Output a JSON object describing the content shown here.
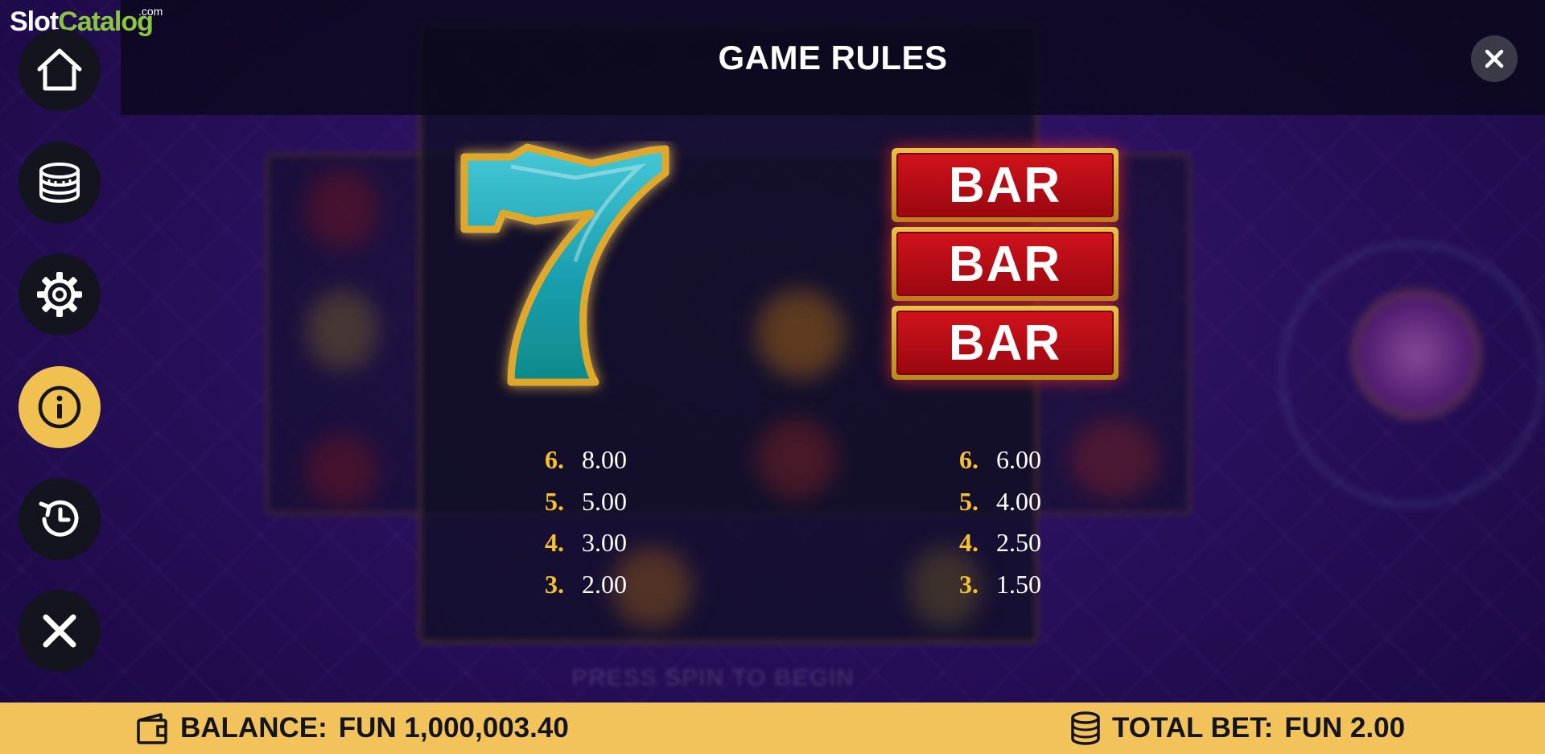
{
  "logo": {
    "part1": "Slot",
    "part2": "Catalog",
    "suffix": ".com"
  },
  "header": {
    "title": "GAME RULES",
    "close_icon": "close-icon"
  },
  "side_menu": [
    {
      "id": "home",
      "icon": "home-icon",
      "active": false
    },
    {
      "id": "coins",
      "icon": "coins-icon",
      "active": false
    },
    {
      "id": "settings",
      "icon": "gear-icon",
      "active": false
    },
    {
      "id": "info",
      "icon": "info-icon",
      "active": true
    },
    {
      "id": "history",
      "icon": "history-icon",
      "active": false
    },
    {
      "id": "close",
      "icon": "close-icon",
      "active": false
    }
  ],
  "symbols": {
    "seven": {
      "icon": "teal-seven-icon",
      "payouts": [
        {
          "count": "6.",
          "value": "8.00"
        },
        {
          "count": "5.",
          "value": "5.00"
        },
        {
          "count": "4.",
          "value": "3.00"
        },
        {
          "count": "3.",
          "value": "2.00"
        }
      ]
    },
    "triple_bar": {
      "icon": "triple-bar-icon",
      "bar_labels": [
        "BAR",
        "BAR",
        "BAR"
      ],
      "payouts": [
        {
          "count": "6.",
          "value": "6.00"
        },
        {
          "count": "5.",
          "value": "4.00"
        },
        {
          "count": "4.",
          "value": "2.50"
        },
        {
          "count": "3.",
          "value": "1.50"
        }
      ]
    }
  },
  "background": {
    "press_text": "PRESS SPIN TO BEGIN"
  },
  "footer": {
    "balance_label": "BALANCE:",
    "balance_value": "FUN 1,000,003.40",
    "bet_label": "TOTAL BET:",
    "bet_value": "FUN 2.00"
  },
  "colors": {
    "accent": "#f2c35a",
    "count": "#f5c22d",
    "bar_red": "#d0121c",
    "seven_teal": "#1fa6b4"
  }
}
